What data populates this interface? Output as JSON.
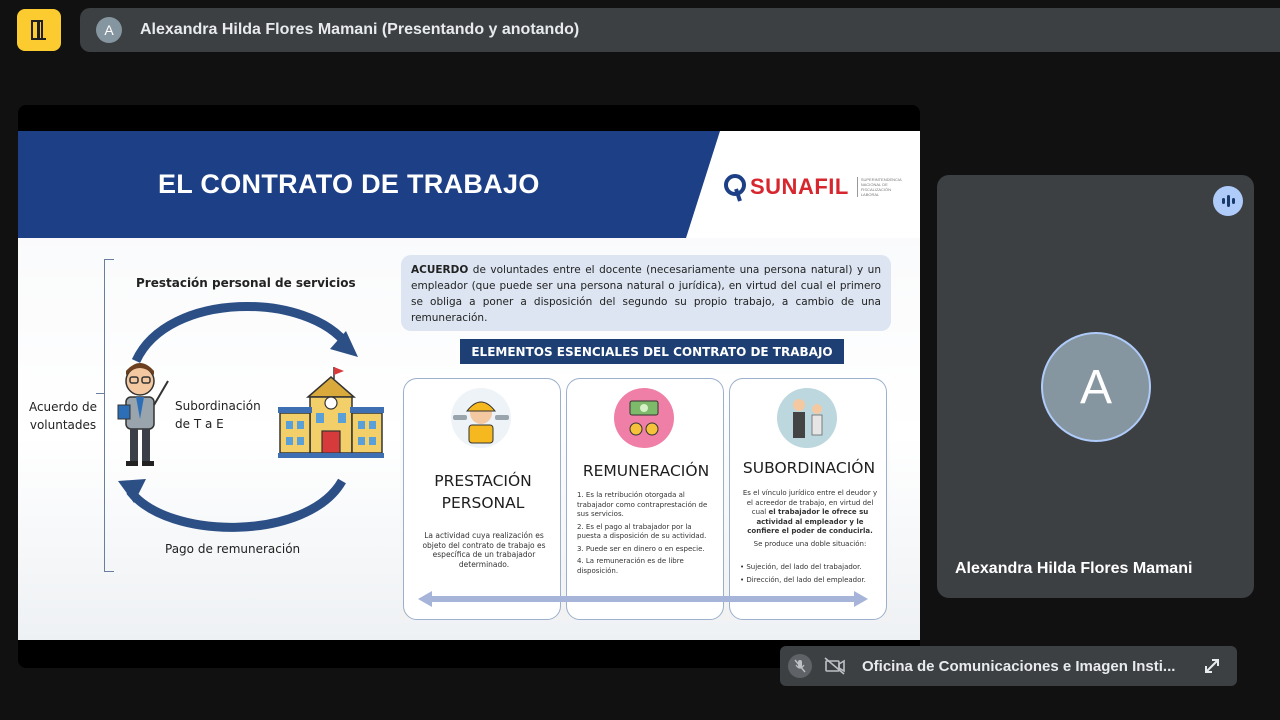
{
  "presenter": {
    "avatar_letter": "A",
    "label": "Alexandra Hilda Flores Mamani (Presentando y anotando)"
  },
  "slide": {
    "title": "EL CONTRATO DE TRABAJO",
    "logo_text": "SUNAFIL",
    "logo_subtext": "SUPERINTENDENCIA NACIONAL DE FISCALIZACIÓN LABORAL",
    "diagram": {
      "left_label": "Acuerdo de voluntades",
      "top_label": "Prestación personal de servicios",
      "middle_label": "Subordinación de T a E",
      "bottom_label": "Pago de remuneración"
    },
    "info_bold": "ACUERDO",
    "info_text": " de voluntades entre el docente (necesariamente una persona natural) y un empleador (que puede ser una persona natural o jurídica), en virtud del cual el primero se obliga a poner a disposición del segundo su propio trabajo, a cambio de una remuneración.",
    "elements_title": "ELEMENTOS ESENCIALES DEL CONTRATO DE TRABAJO",
    "cards": [
      {
        "title_line1": "PRESTACIÓN",
        "title_line2": "PERSONAL",
        "body": "La actividad cuya realización es objeto del contrato de trabajo es específica de un trabajador determinado."
      },
      {
        "title_line1": "REMUNERACIÓN",
        "items": [
          "1. Es la retribución otorgada al trabajador como contraprestación de sus servicios.",
          "2. Es el pago al trabajador por la puesta a disposición de su actividad.",
          "3. Puede ser en dinero o en especie.",
          "4. La remuneración es de libre disposición."
        ]
      },
      {
        "title_line1": "SUBORDINACIÓN",
        "body_start": "Es el vínculo jurídico entre el deudor y el acreedor de trabajo, en virtud del cual ",
        "body_bold": "el trabajador le ofrece su actividad al empleador y le confiere el poder de conducirla.",
        "situation": "Se produce una doble situación:",
        "bullets": [
          "Sujeción, del lado del trabajador.",
          "Dirección, del lado del empleador."
        ]
      }
    ]
  },
  "participant": {
    "avatar_letter": "A",
    "name": "Alexandra Hilda Flores Mamani"
  },
  "self_view": {
    "label": "Oficina de Comunicaciones e Imagen Insti..."
  },
  "colors": {
    "present_button": "#fbcb2f",
    "slide_header": "#1d3f85",
    "sunafil_red": "#d7262d",
    "speaking_indicator": "#aecbfa"
  }
}
